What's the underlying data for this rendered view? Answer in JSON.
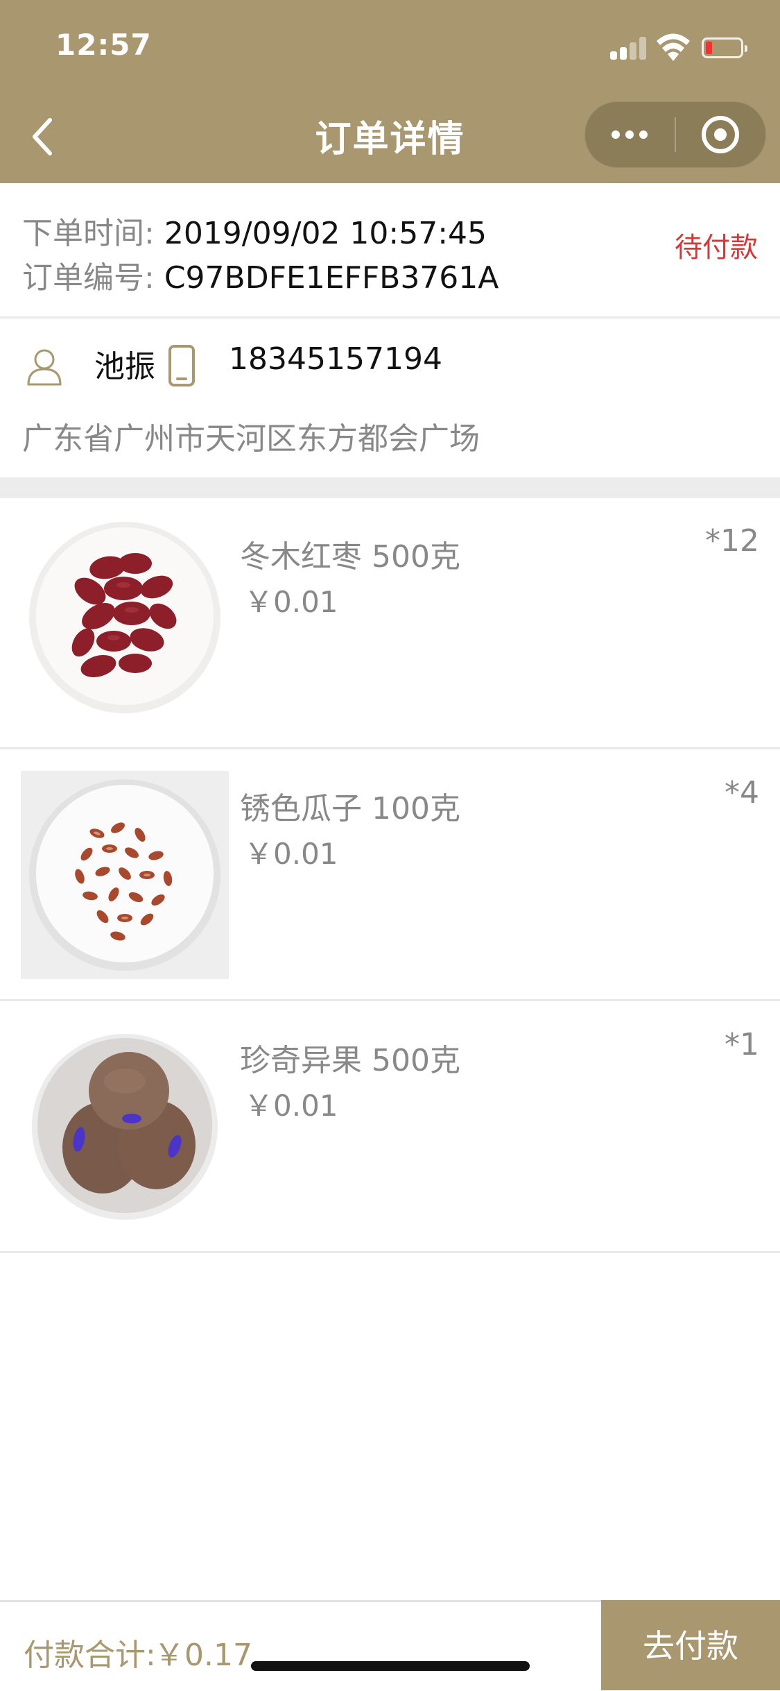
{
  "status_bar": {
    "time": "12:57"
  },
  "nav": {
    "title": "订单详情"
  },
  "order": {
    "time_label": "下单时间:",
    "time_value": "2019/09/02 10:57:45",
    "number_label": "订单编号:",
    "number_value": "C97BDFE1EFFB3761A",
    "status": "待付款",
    "status_color": "#d2393b"
  },
  "contact": {
    "name": "池振",
    "phone": "18345157194",
    "address": "广东省广州市天河区东方都会广场"
  },
  "products": [
    {
      "name": "冬木红枣 500克",
      "price": "￥0.01",
      "qty": "*12",
      "image": "red-dates-plate"
    },
    {
      "name": "锈色瓜子 100克",
      "price": "￥0.01",
      "qty": "*4",
      "image": "melon-seeds-plate"
    },
    {
      "name": "珍奇异果 500克",
      "price": "￥0.01",
      "qty": "*1",
      "image": "kiwi-fruit-plate"
    }
  ],
  "footer": {
    "total_label": "付款合计:",
    "total_value": "￥0.17",
    "pay_button": "去付款"
  },
  "colors": {
    "brand": "#a8976f",
    "muted_text": "#888888",
    "divider": "#e9e9e9"
  }
}
